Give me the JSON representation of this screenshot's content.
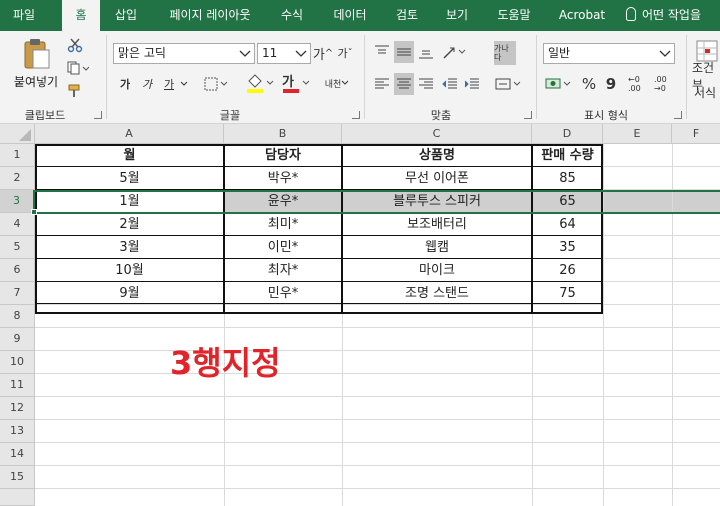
{
  "tabs": [
    "파일",
    "홈",
    "삽입",
    "페이지 레이아웃",
    "수식",
    "데이터",
    "검토",
    "보기",
    "도움말",
    "Acrobat"
  ],
  "active_tab": "홈",
  "tell_me": "어떤 작업을",
  "ribbon": {
    "clipboard": {
      "paste": "붙여넣기",
      "group": "클립보드"
    },
    "font": {
      "name": "맑은 고딕",
      "size": "11",
      "bold": "가",
      "italic": "가",
      "underline": "가",
      "group": "글꼴",
      "color_letter": "가",
      "phonetic": "내천"
    },
    "alignment": {
      "group": "맞춤",
      "wrap": "가나다"
    },
    "number": {
      "format": "일반",
      "group": "표시 형식",
      "percent": "%",
      "comma": "9",
      "inc": "←0 .00",
      "dec": ".00 →0"
    },
    "styles": {
      "cond": "조건부",
      "format": "서식"
    }
  },
  "columns": [
    "A",
    "B",
    "C",
    "D",
    "E",
    "F"
  ],
  "rows": [
    "1",
    "2",
    "3",
    "4",
    "5",
    "6",
    "7",
    "8",
    "9",
    "10",
    "11",
    "12",
    "13",
    "14",
    "15"
  ],
  "selected_row": "3",
  "table": {
    "headers": [
      "월",
      "담당자",
      "상품명",
      "판매 수량"
    ],
    "data": [
      [
        "5월",
        "박우*",
        "무선 이어폰",
        "85"
      ],
      [
        "1월",
        "윤우*",
        "블루투스 스피커",
        "65"
      ],
      [
        "2월",
        "최미*",
        "보조배터리",
        "64"
      ],
      [
        "3월",
        "이민*",
        "웹캠",
        "35"
      ],
      [
        "10월",
        "최자*",
        "마이크",
        "26"
      ],
      [
        "9월",
        "민우*",
        "조명 스탠드",
        "75"
      ]
    ]
  },
  "annotation": "3행지정",
  "colors": {
    "excel_green": "#217346",
    "annotation_red": "#e0242a",
    "selection_gray": "#cfcfcf"
  }
}
